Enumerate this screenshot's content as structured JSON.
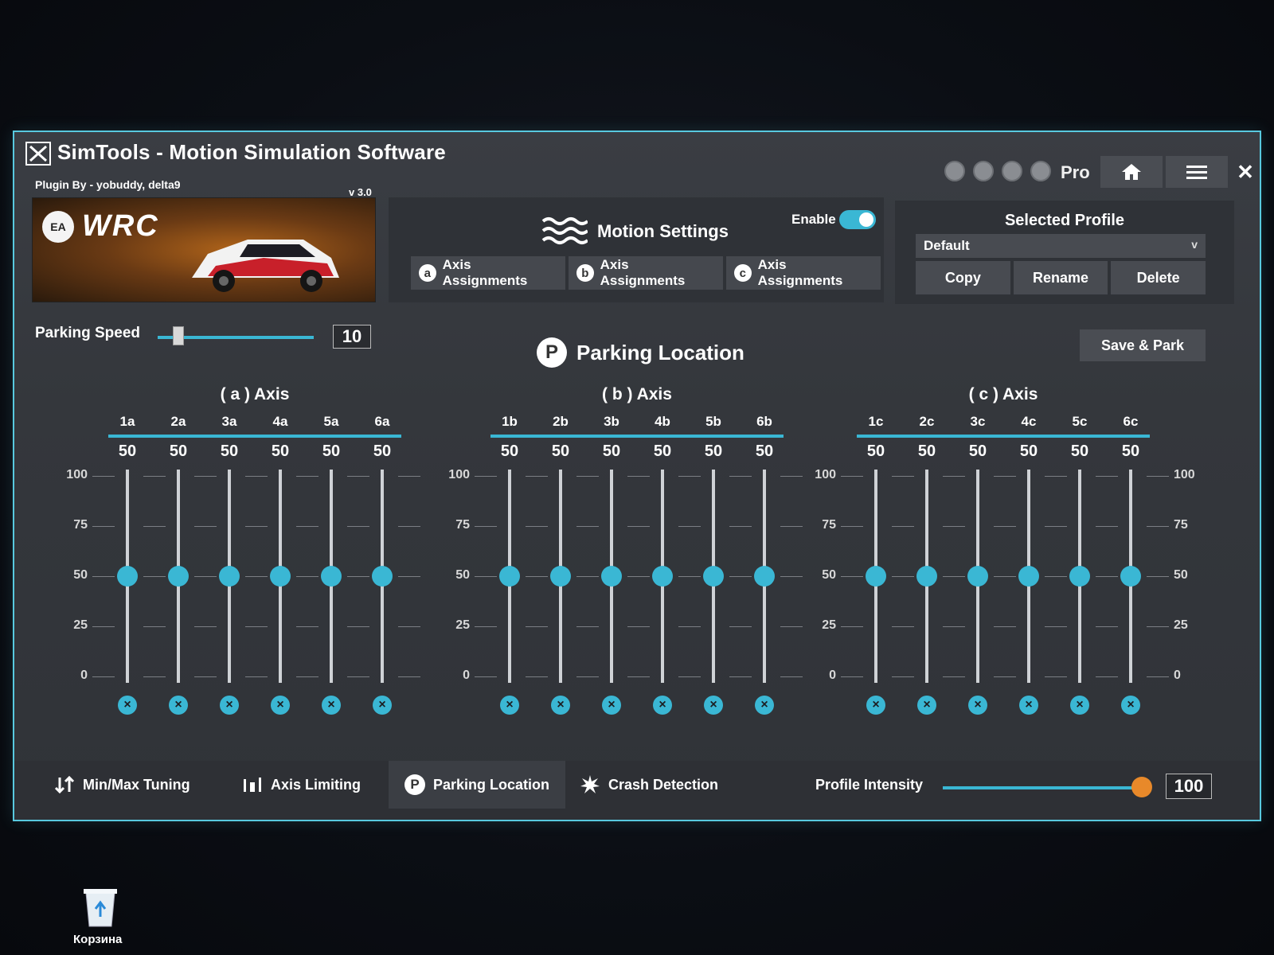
{
  "window": {
    "title": "SimTools - Motion Simulation Software",
    "plugin_by": "Plugin By - yobuddy, delta9",
    "version": "v 3.0",
    "pro_label": "Pro",
    "close_glyph": "✕"
  },
  "banner": {
    "ea": "EA",
    "wrc": "WRC"
  },
  "motion": {
    "title": "Motion Settings",
    "enable_label": "Enable",
    "enabled": true,
    "tabs": [
      {
        "letter": "a",
        "label": "Axis Assignments"
      },
      {
        "letter": "b",
        "label": "Axis Assignments"
      },
      {
        "letter": "c",
        "label": "Axis Assignments"
      }
    ]
  },
  "profile": {
    "title": "Selected Profile",
    "selected": "Default",
    "chevron": "v",
    "buttons": [
      "Copy",
      "Rename",
      "Delete"
    ]
  },
  "parking_speed": {
    "label": "Parking Speed",
    "value": "10",
    "fraction": 0.1
  },
  "parking_location": {
    "icon_letter": "P",
    "title": "Parking Location",
    "save_label": "Save & Park"
  },
  "scale_ticks": [
    "100",
    "75",
    "50",
    "25",
    "0"
  ],
  "reset_glyph": "×",
  "groups": [
    {
      "title": "( a ) Axis",
      "columns": [
        {
          "label": "1a",
          "value": "50",
          "level": 50
        },
        {
          "label": "2a",
          "value": "50",
          "level": 50
        },
        {
          "label": "3a",
          "value": "50",
          "level": 50
        },
        {
          "label": "4a",
          "value": "50",
          "level": 50
        },
        {
          "label": "5a",
          "value": "50",
          "level": 50
        },
        {
          "label": "6a",
          "value": "50",
          "level": 50
        }
      ]
    },
    {
      "title": "( b ) Axis",
      "columns": [
        {
          "label": "1b",
          "value": "50",
          "level": 50
        },
        {
          "label": "2b",
          "value": "50",
          "level": 50
        },
        {
          "label": "3b",
          "value": "50",
          "level": 50
        },
        {
          "label": "4b",
          "value": "50",
          "level": 50
        },
        {
          "label": "5b",
          "value": "50",
          "level": 50
        },
        {
          "label": "6b",
          "value": "50",
          "level": 50
        }
      ]
    },
    {
      "title": "( c ) Axis",
      "columns": [
        {
          "label": "1c",
          "value": "50",
          "level": 50
        },
        {
          "label": "2c",
          "value": "50",
          "level": 50
        },
        {
          "label": "3c",
          "value": "50",
          "level": 50
        },
        {
          "label": "4c",
          "value": "50",
          "level": 50
        },
        {
          "label": "5c",
          "value": "50",
          "level": 50
        },
        {
          "label": "6c",
          "value": "50",
          "level": 50
        }
      ]
    }
  ],
  "bottom_tabs": [
    {
      "label": "Min/Max Tuning",
      "icon": "min-max-icon",
      "active": false
    },
    {
      "label": "Axis Limiting",
      "icon": "axis-limit-icon",
      "active": false
    },
    {
      "label": "Parking Location",
      "icon": "parking-icon",
      "active": true
    },
    {
      "label": "Crash Detection",
      "icon": "crash-icon",
      "active": false
    }
  ],
  "profile_intensity": {
    "label": "Profile Intensity",
    "value": "100",
    "fraction": 1.0
  },
  "desktop": {
    "recycle_label": "Корзина"
  },
  "colors": {
    "accent": "#3ab7d4",
    "orange": "#e8892a",
    "border": "#58c9df"
  }
}
